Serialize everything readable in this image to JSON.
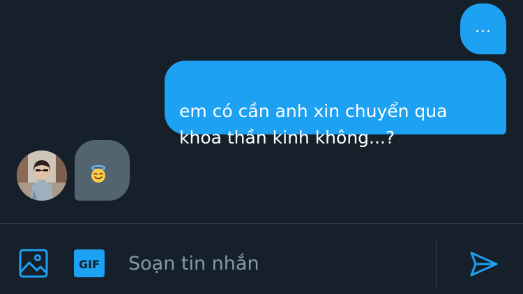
{
  "conversation": {
    "messages": [
      {
        "direction": "outgoing",
        "text": "..."
      },
      {
        "direction": "outgoing",
        "text": "em có cần anh xin chuyển qua\nkhoa thần kinh không...?"
      },
      {
        "direction": "incoming",
        "emoji": "smiling-face-with-halo"
      }
    ]
  },
  "composer": {
    "placeholder": "Soạn tin nhắn",
    "gif_label": "GIF",
    "icons": [
      "image-icon",
      "gif-icon",
      "send-icon"
    ]
  },
  "colors": {
    "background": "#15202b",
    "outgoing_bubble": "#1da1f2",
    "incoming_bubble": "#536471",
    "accent": "#1da1f2",
    "divider": "#38444d",
    "placeholder": "#8899a6"
  }
}
